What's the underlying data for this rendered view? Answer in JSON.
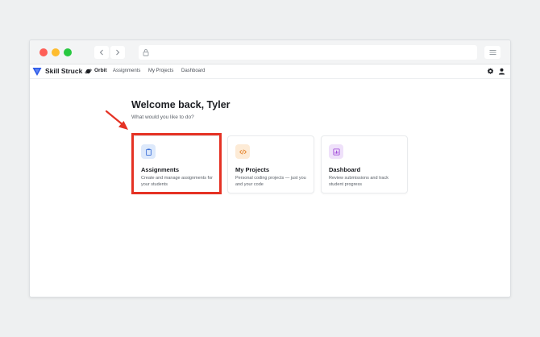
{
  "nav": {
    "brand": "Skill Struck",
    "product": "Orbit",
    "links": [
      "Assignments",
      "My Projects",
      "Dashboard"
    ]
  },
  "main": {
    "title": "Welcome back, Tyler",
    "subtitle": "What would you like to do?",
    "cards": [
      {
        "title": "Assignments",
        "description": "Create and manage assignments for your students",
        "icon": "clipboard-icon",
        "icon_bg": "#dde9fb",
        "icon_color": "#3a6fd8"
      },
      {
        "title": "My Projects",
        "description": "Personal coding projects — just you and your code",
        "icon": "code-icon",
        "icon_bg": "#fdebd6",
        "icon_color": "#e27a1c"
      },
      {
        "title": "Dashboard",
        "description": "Review submissions and track student progress",
        "icon": "bar-chart-icon",
        "icon_bg": "#efe1fa",
        "icon_color": "#9a3fd6"
      }
    ]
  },
  "colors": {
    "highlight": "#e53224",
    "brand_blue": "#2a57e8"
  }
}
